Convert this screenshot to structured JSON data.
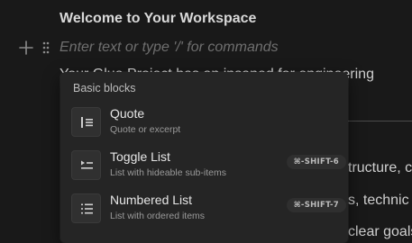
{
  "document": {
    "title": "Welcome to Your Workspace",
    "placeholder": "Enter text or type '/' for commands",
    "background_lines": [
      "Your Glue Project has an insaned for engineering",
      "tructure, c",
      "s, technic",
      "clear goals"
    ]
  },
  "toolbar": {
    "add_icon": "plus-icon",
    "drag_icon": "drag-handle-icon"
  },
  "menu": {
    "section_title": "Basic blocks",
    "items": [
      {
        "label": "Quote",
        "description": "Quote or excerpt",
        "shortcut": "",
        "icon": "quote-icon"
      },
      {
        "label": "Toggle List",
        "description": "List with hideable sub-items",
        "shortcut": "⌘-SHIFT-6",
        "icon": "toggle-list-icon"
      },
      {
        "label": "Numbered List",
        "description": "List with ordered items",
        "shortcut": "⌘-SHIFT-7",
        "icon": "numbered-list-icon"
      }
    ]
  },
  "colors": {
    "background": "#191919",
    "menu_background": "#252525",
    "text_primary": "#e6e6e6",
    "text_muted": "#9a9a9a"
  }
}
